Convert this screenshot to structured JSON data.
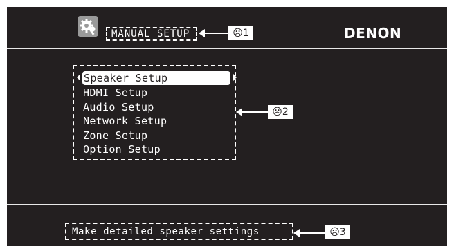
{
  "header": {
    "icon": "gear-wrench-icon",
    "title": "MANUAL SETUP",
    "brand": "DENON",
    "callout": "☹1"
  },
  "menu": {
    "items": [
      {
        "label": "Speaker Setup",
        "selected": true
      },
      {
        "label": "HDMI Setup",
        "selected": false
      },
      {
        "label": "Audio Setup",
        "selected": false
      },
      {
        "label": "Network Setup",
        "selected": false
      },
      {
        "label": "Zone Setup",
        "selected": false
      },
      {
        "label": "Option Setup",
        "selected": false
      }
    ],
    "callout": "☹2"
  },
  "footer": {
    "hint": "Make detailed speaker settings",
    "callout": "☹3"
  },
  "colors": {
    "screen_bg": "#231f20",
    "text": "#ffffff",
    "selection_bg": "#ffffff"
  }
}
